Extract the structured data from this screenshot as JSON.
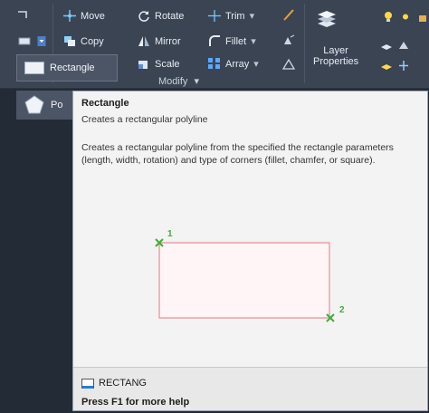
{
  "ribbon": {
    "move": "Move",
    "rotate": "Rotate",
    "trim": "Trim",
    "copy": "Copy",
    "mirror": "Mirror",
    "fillet": "Fillet",
    "scale": "Scale",
    "array": "Array",
    "layer_properties_line1": "Layer",
    "layer_properties_line2": "Properties",
    "modify_panel": "Modify"
  },
  "draw_dropdown": {
    "rectangle": "Rectangle",
    "polygon": "Po"
  },
  "tooltip": {
    "title": "Rectangle",
    "short_desc": "Creates a rectangular polyline",
    "long_desc": "Creates a rectangular polyline from the specified the rectangle parameters (length, width, rotation) and type of corners (fillet, chamfer, or square).",
    "point1": "1",
    "point2": "2",
    "command": "RECTANG",
    "help": "Press F1 for more help"
  }
}
